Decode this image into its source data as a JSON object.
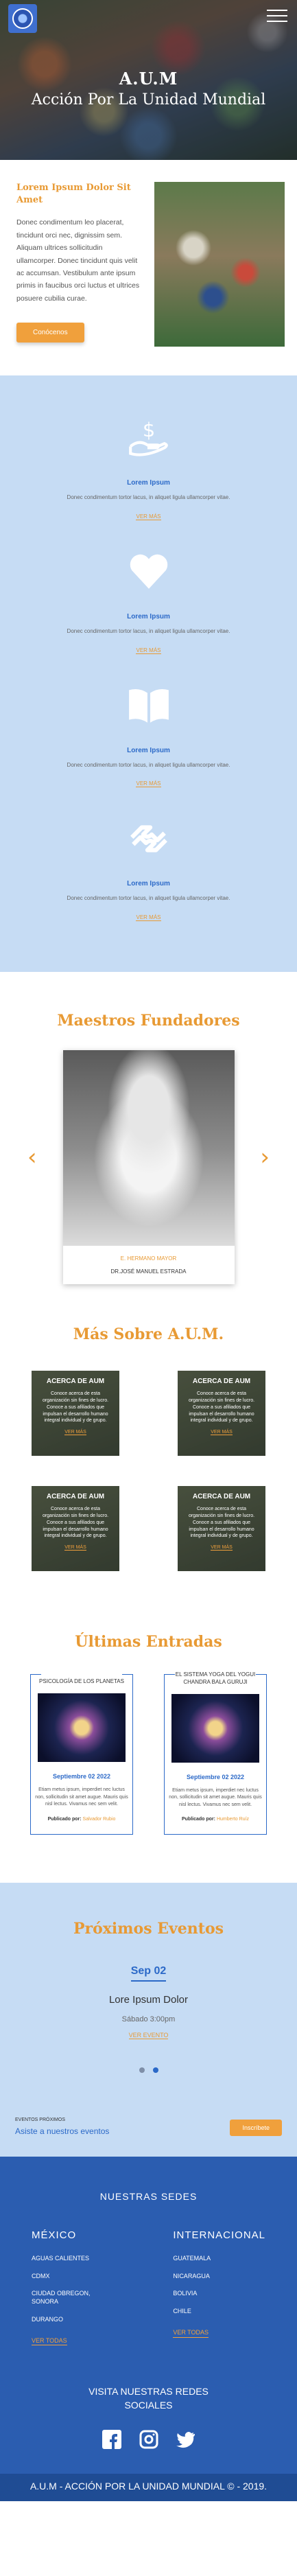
{
  "hero": {
    "line1": "A.U.M",
    "line2": "Acción Por La Unidad Mundial"
  },
  "intro": {
    "title": "Lorem Ipsum Dolor Sit Amet",
    "body": "Donec condimentum leo placerat, tincidunt orci nec, dignissim sem. Aliquam ultrices sollicitudin ullamcorper. Donec tincidunt quis velit ac accumsan. Vestibulum ante ipsum primis in faucibus orci luctus et ultrices posuere cubilia curae.",
    "button": "Conócenos"
  },
  "services": [
    {
      "icon": "hand-money-icon",
      "title": "Lorem Ipsum",
      "text": "Donec condimentum tortor lacus, in aliquet ligula ullamcorper vitae.",
      "more": "VER MÁS"
    },
    {
      "icon": "heart-icon",
      "title": "Lorem Ipsum",
      "text": "Donec condimentum tortor lacus, in aliquet ligula ullamcorper vitae.",
      "more": "VER MÁS"
    },
    {
      "icon": "book-icon",
      "title": "Lorem Ipsum",
      "text": "Donec condimentum tortor lacus, in aliquet ligula ullamcorper vitae.",
      "more": "VER MÁS"
    },
    {
      "icon": "handshake-icon",
      "title": "Lorem Ipsum",
      "text": "Donec condimentum tortor lacus, in aliquet ligula ullamcorper vitae.",
      "more": "VER MÁS"
    }
  ],
  "founders": {
    "title": "Maestros Fundadores",
    "role": "E. HERMANO MAYOR",
    "name": "DR.JOSÉ MANUEL ESTRADA"
  },
  "more_about": {
    "title": "Más Sobre A.U.M.",
    "tiles": [
      {
        "title": "ACERCA DE AUM",
        "text": "Conoce acerca de esta organización sin fines de lucro. Conoce a sus afiliados que impulsan el desarrollo humano integral individual y de grupo.",
        "more": "VER MÁS"
      },
      {
        "title": "ACERCA DE AUM",
        "text": "Conoce acerca de esta organización sin fines de lucro. Conoce a sus afiliados que impulsan el desarrollo humano integral individual y de grupo.",
        "more": "VER MÁS"
      },
      {
        "title": "ACERCA DE AUM",
        "text": "Conoce acerca de esta organización sin fines de lucro. Conoce a sus afiliados que impulsan el desarrollo humano integral individual y de grupo.",
        "more": "VER MÁS"
      },
      {
        "title": "ACERCA DE AUM",
        "text": "Conoce acerca de esta organización sin fines de lucro. Conoce a sus afiliados que impulsan el desarrollo humano integral individual y de grupo.",
        "more": "VER MÁS"
      }
    ]
  },
  "latest": {
    "title": "Últimas Entradas",
    "posts": [
      {
        "title": "PSICOLOGÍA DE LOS PLANETAS",
        "date": "Septiembre 02 2022",
        "text": "Etiam metus ipsum, imperdiet nec luctus non, sollicitudin sit amet augue. Mauris quis nisl lectus. Vivamus nec sem velit.",
        "by": "Publicado por:",
        "author": "Salvador Rubio"
      },
      {
        "title": "EL SISTEMA YOGA DEL YOGUI CHANDRA BALA GURUJI",
        "date": "Septiembre 02 2022",
        "text": "Etiam metus ipsum, imperdiet nec luctus non, sollicitudin sit amet augue. Mauris quis nisl lectus. Vivamus nec sem velit.",
        "by": "Publicado por:",
        "author": "Humberto Ruíz"
      }
    ]
  },
  "events": {
    "title": "Próximos Eventos",
    "date": "Sep 02",
    "event_title": "Lore Ipsum Dolor",
    "time": "Sábado 3:00pm",
    "more": "VER EVENTO",
    "upcoming_label": "EVENTOS PRÓXIMOS",
    "assist": "Asiste a nuestros eventos",
    "button": "Inscríbete"
  },
  "footer": {
    "title": "NUESTRAS SEDES",
    "mexico": {
      "name": "MÉXICO",
      "items": [
        "AGUAS CALIENTES",
        "CDMX",
        "CIUDAD OBREGON, SONORA",
        "DURANGO"
      ],
      "all": "VER TODAS"
    },
    "international": {
      "name": "INTERNACIONAL",
      "items": [
        "GUATEMALA",
        "NICARAGUA",
        "BOLIVIA",
        "CHILE"
      ],
      "all": "VER TODAS"
    },
    "social_title": "VISITA NUESTRAS REDES SOCIALES",
    "copyright": "A.U.M - ACCIÓN POR LA UNIDAD MUNDIAL © - 2019."
  },
  "colors": {
    "accent": "#e89a34",
    "primary": "#2b69c8",
    "light_blue": "#c6dcf4",
    "footer": "#2b5db0"
  }
}
